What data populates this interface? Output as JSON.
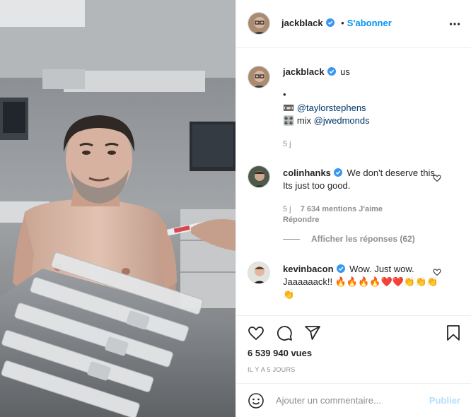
{
  "header": {
    "username": "jackblack",
    "separator": "•",
    "follow_label": "S'abonner"
  },
  "caption": {
    "username": "jackblack",
    "text": "us",
    "bullet": "•",
    "line1_emoji": "📼",
    "line1_mention": "@taylorstephens",
    "line2_emoji": "🎛️",
    "line2_prefix": "mix",
    "line2_mention": "@jwedmonds",
    "time": "5 j"
  },
  "comments": [
    {
      "username": "colinhanks",
      "text": "We don't deserve this. Its just too good.",
      "time": "5 j",
      "likes": "7 634 mentions J'aime",
      "reply": "Répondre",
      "view_replies": "Afficher les réponses (62)"
    },
    {
      "username": "kevinbacon",
      "text": "Wow. Just wow. Jaaaaaack!! 🔥🔥🔥🔥❤️❤️👏👏👏👏"
    }
  ],
  "stats": {
    "views": "6 539 940 vues",
    "date": "IL Y A 5 JOURS"
  },
  "add_comment": {
    "placeholder": "Ajouter un commentaire...",
    "publish": "Publier"
  },
  "colors": {
    "link": "#0095f6",
    "verified": "#3897f0",
    "muted": "#8e8e8e",
    "publish_disabled": "#b2dffc"
  },
  "icons": [
    "verified-badge-icon",
    "more-options-icon",
    "heart-icon",
    "comment-icon",
    "share-icon",
    "bookmark-icon",
    "emoji-icon"
  ]
}
